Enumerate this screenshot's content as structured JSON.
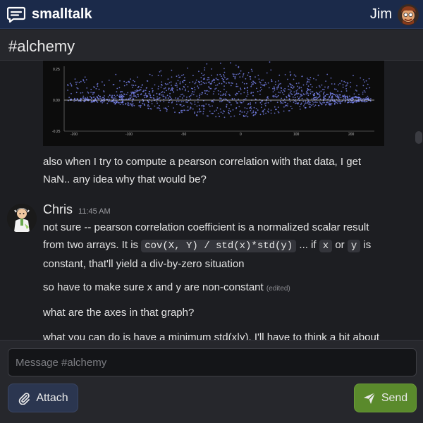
{
  "app": {
    "name": "smalltalk"
  },
  "user": {
    "name": "Jim"
  },
  "channel": {
    "name": "#alchemy"
  },
  "messages": {
    "previous": {
      "line1": "also when I try to compute a pearson correlation with that data, I get",
      "line2": "NaN.. any idea why that would be?"
    },
    "chris": {
      "author": "Chris",
      "time": "11:45 AM",
      "p1_line1": "not sure -- pearson correlation coefficient is a normalized scalar result",
      "p1_line2_pre": "from two arrays. It is",
      "p1_code": "cov(X, Y) / std(x)*std(y)",
      "p1_line2_mid": "... if",
      "p1_code_x": "x",
      "p1_line2_or": "or",
      "p1_code_y": "y",
      "p1_line2_post": "is",
      "p1_line3": "constant, that'll yield a div-by-zero situation",
      "p2": "so have to make sure x and y are non-constant",
      "p2_edited": "(edited)",
      "p3": "what are the axes in that graph?",
      "p4": "what you can do is have a minimum std(x|y). I'll have to think a bit about"
    }
  },
  "plot": {
    "y_ticks": [
      "0.25",
      "0.00",
      "-0.25"
    ],
    "x_ticks": [
      "-200",
      "-100",
      "-50",
      "0",
      "100",
      "200"
    ]
  },
  "composer": {
    "placeholder": "Message #alchemy",
    "attach_label": "Attach",
    "send_label": "Send"
  },
  "colors": {
    "topbar": "#1b2a4a",
    "send": "#5a8a2c",
    "attach": "#2b3650",
    "plot_points": "#7b86f2"
  }
}
